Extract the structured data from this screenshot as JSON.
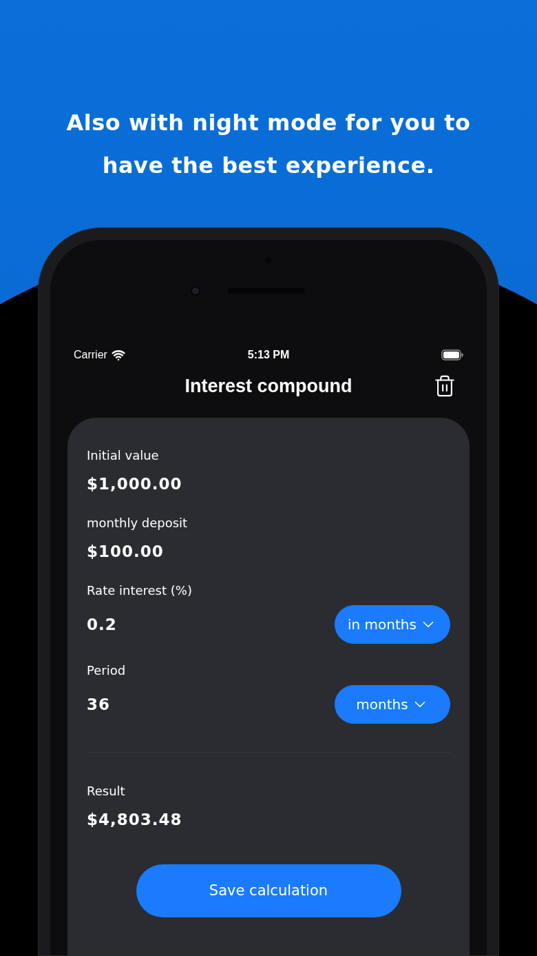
{
  "headline": "Also with night mode for you to have the best experience.",
  "status_bar": {
    "carrier": "Carrier",
    "time": "5:13 PM"
  },
  "nav": {
    "title": "Interest compound"
  },
  "fields": [
    {
      "label": "Initial value",
      "value": "$1,000.00"
    },
    {
      "label": "monthly deposit",
      "value": "$100.00"
    },
    {
      "label": "Rate interest (%)",
      "value": "0.2",
      "unit": "in months"
    },
    {
      "label": "Period",
      "value": "36",
      "unit": "months"
    }
  ],
  "result": {
    "label": "Result",
    "value": "$4,803.48"
  },
  "save_button": "Save calculation"
}
